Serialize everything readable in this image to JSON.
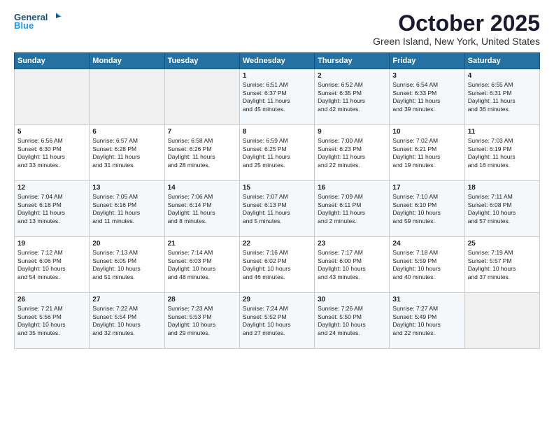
{
  "logo": {
    "line1": "General",
    "line2": "Blue"
  },
  "title": "October 2025",
  "location": "Green Island, New York, United States",
  "headers": [
    "Sunday",
    "Monday",
    "Tuesday",
    "Wednesday",
    "Thursday",
    "Friday",
    "Saturday"
  ],
  "weeks": [
    [
      {
        "day": "",
        "info": ""
      },
      {
        "day": "",
        "info": ""
      },
      {
        "day": "",
        "info": ""
      },
      {
        "day": "1",
        "info": "Sunrise: 6:51 AM\nSunset: 6:37 PM\nDaylight: 11 hours\nand 45 minutes."
      },
      {
        "day": "2",
        "info": "Sunrise: 6:52 AM\nSunset: 6:35 PM\nDaylight: 11 hours\nand 42 minutes."
      },
      {
        "day": "3",
        "info": "Sunrise: 6:54 AM\nSunset: 6:33 PM\nDaylight: 11 hours\nand 39 minutes."
      },
      {
        "day": "4",
        "info": "Sunrise: 6:55 AM\nSunset: 6:31 PM\nDaylight: 11 hours\nand 36 minutes."
      }
    ],
    [
      {
        "day": "5",
        "info": "Sunrise: 6:56 AM\nSunset: 6:30 PM\nDaylight: 11 hours\nand 33 minutes."
      },
      {
        "day": "6",
        "info": "Sunrise: 6:57 AM\nSunset: 6:28 PM\nDaylight: 11 hours\nand 31 minutes."
      },
      {
        "day": "7",
        "info": "Sunrise: 6:58 AM\nSunset: 6:26 PM\nDaylight: 11 hours\nand 28 minutes."
      },
      {
        "day": "8",
        "info": "Sunrise: 6:59 AM\nSunset: 6:25 PM\nDaylight: 11 hours\nand 25 minutes."
      },
      {
        "day": "9",
        "info": "Sunrise: 7:00 AM\nSunset: 6:23 PM\nDaylight: 11 hours\nand 22 minutes."
      },
      {
        "day": "10",
        "info": "Sunrise: 7:02 AM\nSunset: 6:21 PM\nDaylight: 11 hours\nand 19 minutes."
      },
      {
        "day": "11",
        "info": "Sunrise: 7:03 AM\nSunset: 6:19 PM\nDaylight: 11 hours\nand 16 minutes."
      }
    ],
    [
      {
        "day": "12",
        "info": "Sunrise: 7:04 AM\nSunset: 6:18 PM\nDaylight: 11 hours\nand 13 minutes."
      },
      {
        "day": "13",
        "info": "Sunrise: 7:05 AM\nSunset: 6:16 PM\nDaylight: 11 hours\nand 11 minutes."
      },
      {
        "day": "14",
        "info": "Sunrise: 7:06 AM\nSunset: 6:14 PM\nDaylight: 11 hours\nand 8 minutes."
      },
      {
        "day": "15",
        "info": "Sunrise: 7:07 AM\nSunset: 6:13 PM\nDaylight: 11 hours\nand 5 minutes."
      },
      {
        "day": "16",
        "info": "Sunrise: 7:09 AM\nSunset: 6:11 PM\nDaylight: 11 hours\nand 2 minutes."
      },
      {
        "day": "17",
        "info": "Sunrise: 7:10 AM\nSunset: 6:10 PM\nDaylight: 10 hours\nand 59 minutes."
      },
      {
        "day": "18",
        "info": "Sunrise: 7:11 AM\nSunset: 6:08 PM\nDaylight: 10 hours\nand 57 minutes."
      }
    ],
    [
      {
        "day": "19",
        "info": "Sunrise: 7:12 AM\nSunset: 6:06 PM\nDaylight: 10 hours\nand 54 minutes."
      },
      {
        "day": "20",
        "info": "Sunrise: 7:13 AM\nSunset: 6:05 PM\nDaylight: 10 hours\nand 51 minutes."
      },
      {
        "day": "21",
        "info": "Sunrise: 7:14 AM\nSunset: 6:03 PM\nDaylight: 10 hours\nand 48 minutes."
      },
      {
        "day": "22",
        "info": "Sunrise: 7:16 AM\nSunset: 6:02 PM\nDaylight: 10 hours\nand 46 minutes."
      },
      {
        "day": "23",
        "info": "Sunrise: 7:17 AM\nSunset: 6:00 PM\nDaylight: 10 hours\nand 43 minutes."
      },
      {
        "day": "24",
        "info": "Sunrise: 7:18 AM\nSunset: 5:59 PM\nDaylight: 10 hours\nand 40 minutes."
      },
      {
        "day": "25",
        "info": "Sunrise: 7:19 AM\nSunset: 5:57 PM\nDaylight: 10 hours\nand 37 minutes."
      }
    ],
    [
      {
        "day": "26",
        "info": "Sunrise: 7:21 AM\nSunset: 5:56 PM\nDaylight: 10 hours\nand 35 minutes."
      },
      {
        "day": "27",
        "info": "Sunrise: 7:22 AM\nSunset: 5:54 PM\nDaylight: 10 hours\nand 32 minutes."
      },
      {
        "day": "28",
        "info": "Sunrise: 7:23 AM\nSunset: 5:53 PM\nDaylight: 10 hours\nand 29 minutes."
      },
      {
        "day": "29",
        "info": "Sunrise: 7:24 AM\nSunset: 5:52 PM\nDaylight: 10 hours\nand 27 minutes."
      },
      {
        "day": "30",
        "info": "Sunrise: 7:26 AM\nSunset: 5:50 PM\nDaylight: 10 hours\nand 24 minutes."
      },
      {
        "day": "31",
        "info": "Sunrise: 7:27 AM\nSunset: 5:49 PM\nDaylight: 10 hours\nand 22 minutes."
      },
      {
        "day": "",
        "info": ""
      }
    ]
  ]
}
